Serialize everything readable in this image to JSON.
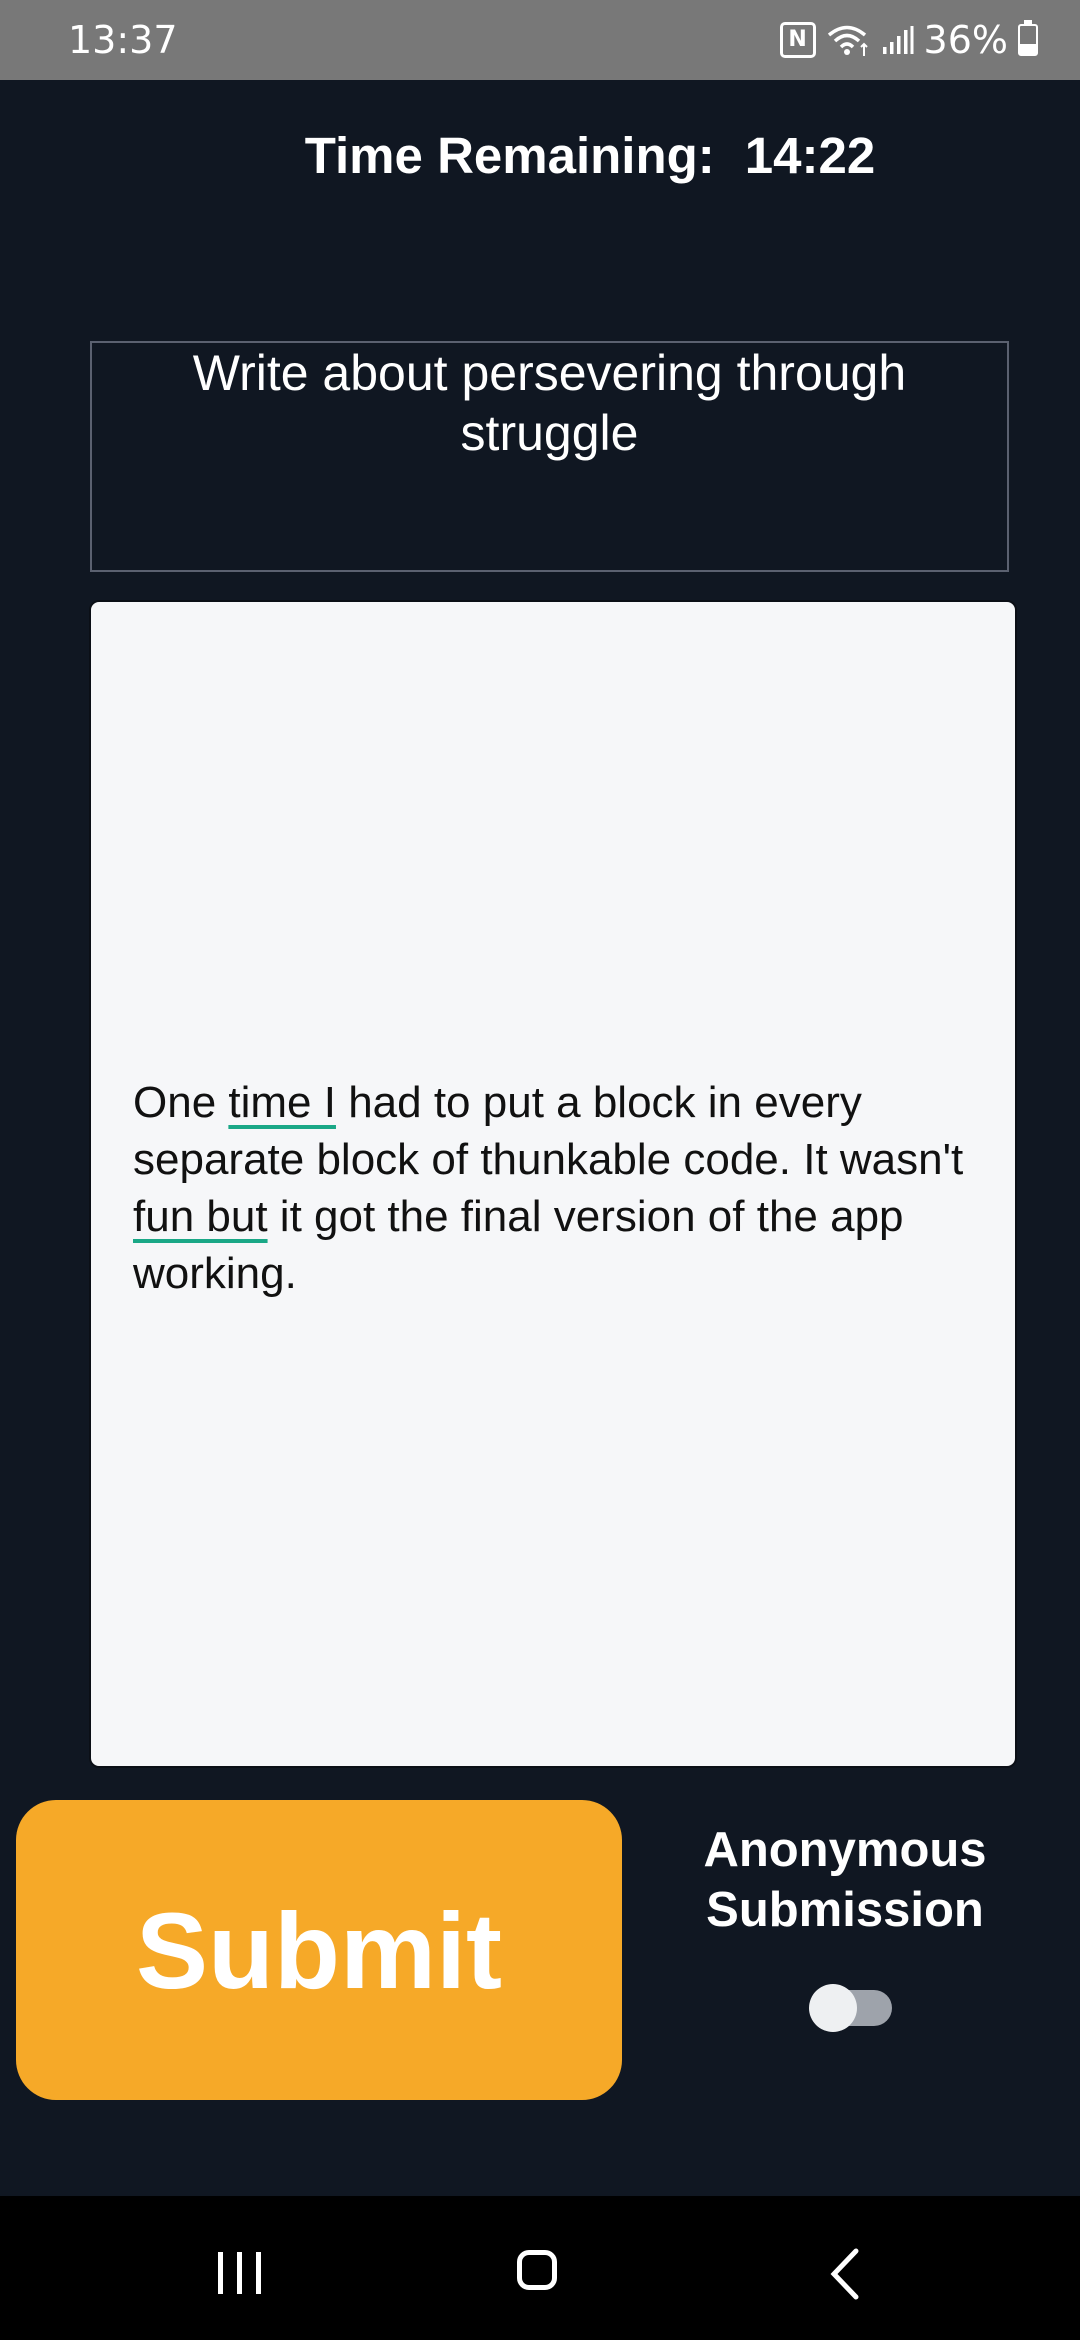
{
  "status_bar": {
    "time": "13:37",
    "nfc_label": "N",
    "battery_percent": "36%",
    "battery_level": 0.36,
    "icons": [
      "nfc-icon",
      "wifi-icon",
      "signal-icon",
      "battery-icon"
    ]
  },
  "timer": {
    "label": "Time Remaining:",
    "value": "14:22"
  },
  "prompt": {
    "text": "Write about persevering through struggle"
  },
  "essay": {
    "segments": [
      {
        "text": "One ",
        "underlined": false
      },
      {
        "text": "time I",
        "underlined": true
      },
      {
        "text": " had to put a block in every separate block of thunkable code. It wasn't ",
        "underlined": false
      },
      {
        "text": "fun but",
        "underlined": true
      },
      {
        "text": " it got the final version of the app working.",
        "underlined": false
      }
    ]
  },
  "submit": {
    "label": "Submit",
    "color": "#f6a928"
  },
  "anonymous": {
    "label_line1": "Anonymous",
    "label_line2": "Submission",
    "toggle_on": false
  },
  "nav_bar": {
    "icons": [
      "recents-icon",
      "home-icon",
      "back-icon"
    ]
  },
  "colors": {
    "background": "#101722",
    "status_bar": "#787878",
    "spellcheck_underline": "#1aa887"
  }
}
